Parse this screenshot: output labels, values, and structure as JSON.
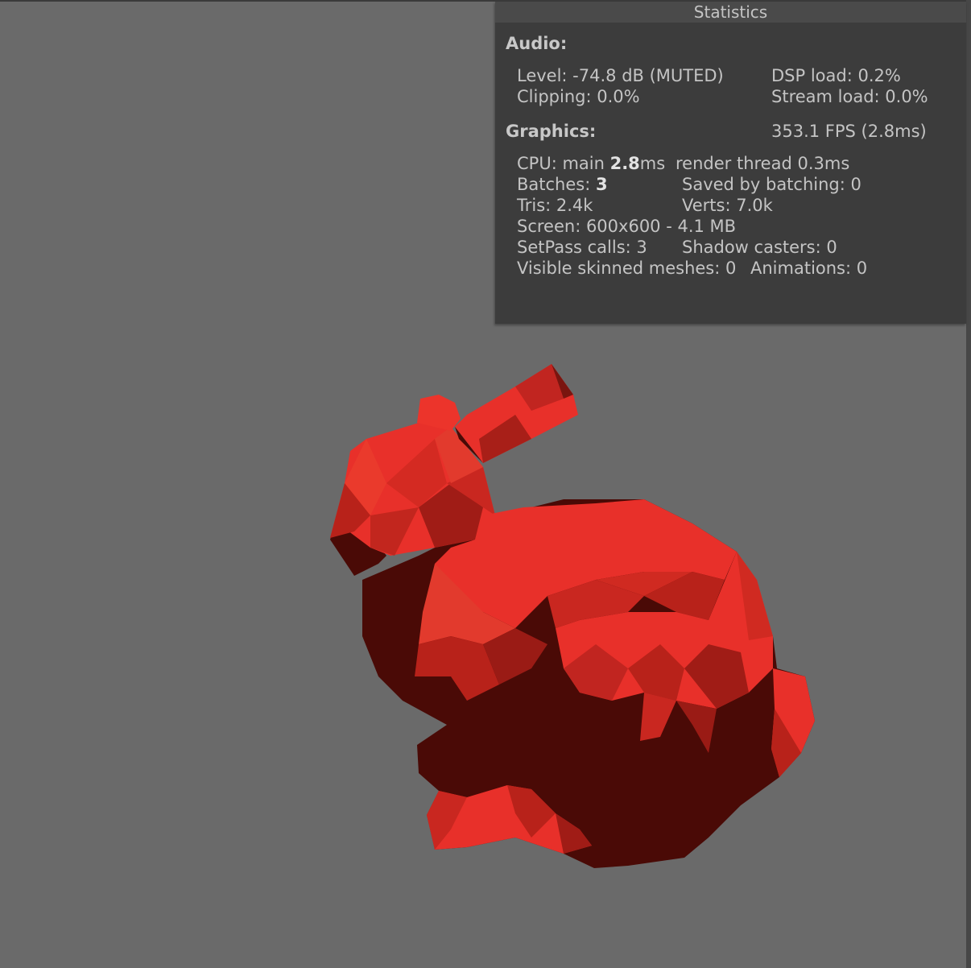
{
  "statistics": {
    "title": "Statistics",
    "audio": {
      "heading": "Audio:",
      "level": "Level: -74.8 dB (MUTED)",
      "dsp_load": "DSP load: 0.2%",
      "clipping": "Clipping: 0.0%",
      "stream_load": "Stream load: 0.0%"
    },
    "graphics": {
      "heading": "Graphics:",
      "fps": "353.1 FPS (2.8ms)",
      "cpu_main_label": "CPU: main ",
      "cpu_main_value": "2.8",
      "cpu_main_unit": "ms",
      "render_thread": "render thread 0.3ms",
      "batches_label": "Batches: ",
      "batches_value": "3",
      "saved_by_batching": "Saved by batching: 0",
      "tris": "Tris: 2.4k",
      "verts": "Verts: 7.0k",
      "screen": "Screen: 600x600 - 4.1 MB",
      "setpass_calls": "SetPass calls: 3",
      "shadow_casters": "Shadow casters: 0",
      "visible_skinned_meshes": "Visible skinned meshes: 0",
      "animations": "Animations: 0"
    }
  },
  "scene": {
    "background_color": "#6a6a6a",
    "model": "low-poly-bunny",
    "model_color": "#e8302a",
    "shadow_color": "#4a0a06"
  }
}
